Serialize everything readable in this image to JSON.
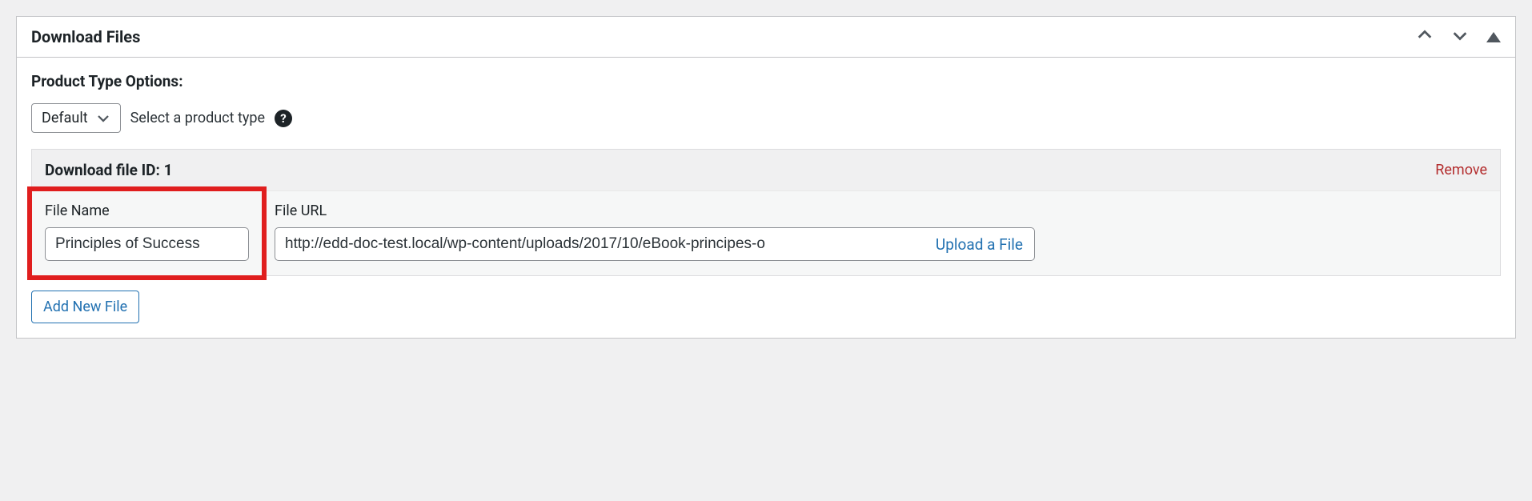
{
  "panel": {
    "title": "Download Files"
  },
  "productType": {
    "label": "Product Type Options:",
    "selectValue": "Default",
    "hint": "Select a product type"
  },
  "fileBlock": {
    "titlePrefix": "Download file ID:",
    "id": "1",
    "removeLabel": "Remove",
    "fileName": {
      "label": "File Name",
      "value": "Principles of Success"
    },
    "fileUrl": {
      "label": "File URL",
      "value": "http://edd-doc-test.local/wp-content/uploads/2017/10/eBook-principes-o",
      "uploadLabel": "Upload a File"
    }
  },
  "addButton": {
    "label": "Add New File"
  }
}
